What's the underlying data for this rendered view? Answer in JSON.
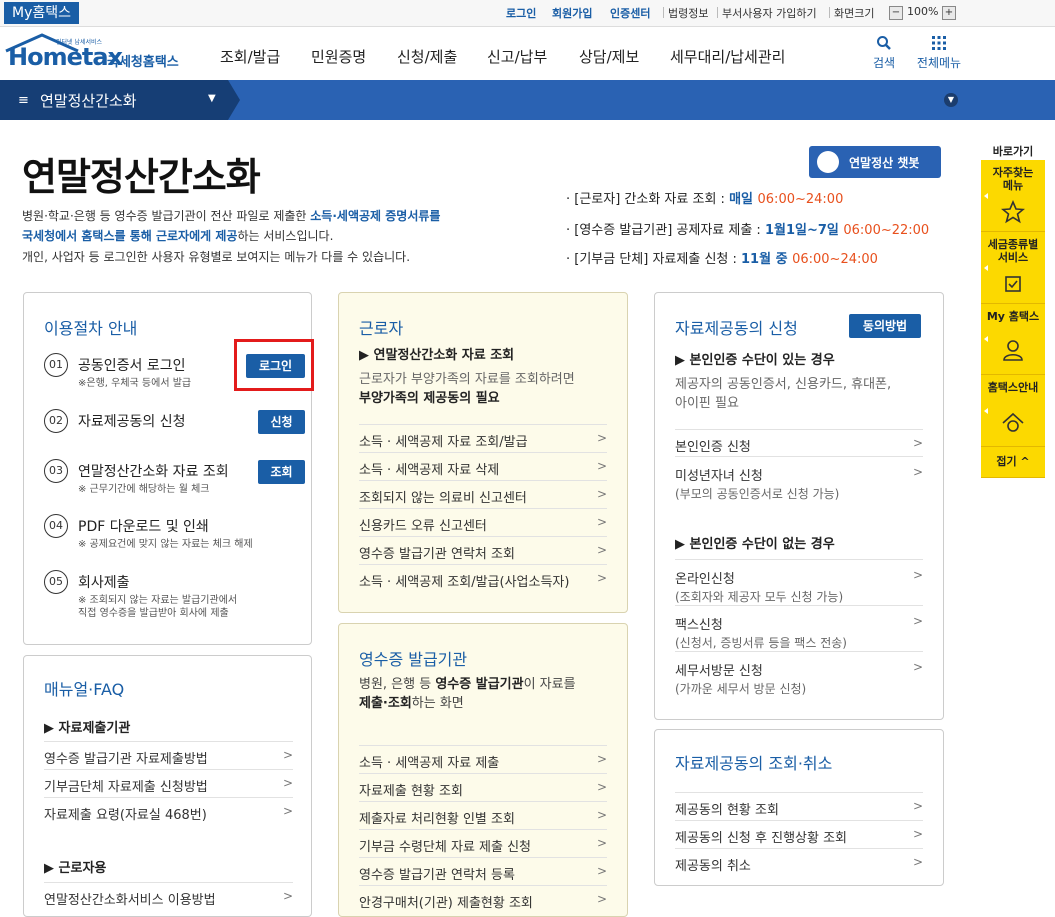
{
  "topbar": {
    "my_hometax": "My홈택스",
    "login": "로그인",
    "join": "회원가입",
    "cert_center": "인증센터",
    "law_info": "법령정보",
    "dept_user_join": "부서사용자 가입하기",
    "screen_size": "화면크기",
    "zoom_minus": "−",
    "zoom_level": "100%",
    "zoom_plus": "+"
  },
  "header": {
    "logo_small": "인터넷 납세서비스",
    "logo_main": "Hometax",
    "logo_sub": "국세청홈택스",
    "menus": [
      "조회/발급",
      "민원증명",
      "신청/제출",
      "신고/납부",
      "상담/제보",
      "세무대리/납세관리"
    ],
    "search_label": "검색",
    "all_menu_label": "전체메뉴"
  },
  "navbar": {
    "title": "연말정산간소화"
  },
  "page": {
    "title": "연말정산간소화",
    "desc1_pre": "병원·학교·은행 등 영수증 발급기관이 전산 파일로 제출한 ",
    "desc1_hl": "소득·세액공제 증명서류를",
    "desc2_hl": "국세청에서 홈택스를 통해 근로자에게 제공",
    "desc2_post": "하는 서비스입니다.",
    "desc3": "개인, 사업자 등 로그인한 사용자 유형별로 보여지는 메뉴가 다를 수 있습니다.",
    "chatbot": "연말정산 챗봇"
  },
  "schedule": [
    {
      "prefix": "· [근로자] 간소화 자료 조회 : ",
      "when": "매일 ",
      "time": "06:00~24:00"
    },
    {
      "prefix": "· [영수증 발급기관] 공제자료 제출 : ",
      "when": "1월1일~7일 ",
      "time": "06:00~22:00"
    },
    {
      "prefix": "· [기부금 단체] 자료제출 신청 : ",
      "when": "11월 중 ",
      "time": "06:00~24:00"
    }
  ],
  "procedure": {
    "title": "이용절차 안내",
    "steps": [
      {
        "num": "01",
        "label": "공동인증서 로그인",
        "note1": "※은행, 우체국 등에서 발급",
        "note2": "",
        "button": "로그인"
      },
      {
        "num": "02",
        "label": "자료제공동의 신청",
        "note1": "",
        "note2": "",
        "button": "신청"
      },
      {
        "num": "03",
        "label": "연말정산간소화 자료 조회",
        "note1": "※ 근무기간에 해당하는 월 체크",
        "note2": "",
        "button": "조회"
      },
      {
        "num": "04",
        "label": "PDF 다운로드 및 인쇄",
        "note1": "※ 공제요건에 맞지 않는 자료는 체크 해제",
        "note2": "",
        "button": ""
      },
      {
        "num": "05",
        "label": "회사제출",
        "note1": "※ 조회되지 않는 자료는 발급기관에서",
        "note2": "직접 영수증을 발급받아 회사에 제출",
        "button": ""
      }
    ]
  },
  "manual": {
    "title": "매뉴얼·FAQ",
    "sub1": "▶ 자료제출기관",
    "items1": [
      "영수증 발급기관 자료제출방법",
      "기부금단체 자료제출 신청방법",
      "자료제출 요령(자료실 468번)"
    ],
    "sub2": "▶ 근로자용",
    "items2": [
      "연말정산간소화서비스 이용방법"
    ]
  },
  "worker": {
    "title": "근로자",
    "sub": "▶ 연말정산간소화 자료 조회",
    "note1": "근로자가 부양가족의 자료를 조회하려면",
    "note2": "부양가족의 제공동의 필요",
    "items": [
      "소득 · 세액공제 자료 조회/발급",
      "소득 · 세액공제 자료 삭제",
      "조회되지 않는 의료비 신고센터",
      "신용카드 오류 신고센터",
      "영수증 발급기관 연락처 조회",
      "소득 · 세액공제 조회/발급(사업소득자)"
    ]
  },
  "issuer": {
    "title": "영수증 발급기관",
    "note1_pre": "병원, 은행 등 ",
    "note1_b": "영수증 발급기관",
    "note1_post": "이 자료를",
    "note2_b": "제출·조회",
    "note2_post": "하는 화면",
    "items": [
      "소득 · 세액공제 자료 제출",
      "자료제출 현황 조회",
      "제출자료 처리현황 인별 조회",
      "기부금 수령단체 자료 제출 신청",
      "영수증 발급기관 연락처 등록",
      "안경구매처(기관) 제출현황 조회"
    ]
  },
  "consent": {
    "title": "자료제공동의 신청",
    "button": "동의방법",
    "sub1": "▶ 본인인증 수단이 있는 경우",
    "note1": "제공자의 공동인증서, 신용카드, 휴대폰,",
    "note2": "아이핀 필요",
    "items1": [
      {
        "label": "본인인증 신청",
        "sub": ""
      },
      {
        "label": "미성년자녀 신청",
        "sub": "(부모의 공동인증서로 신청 가능)"
      }
    ],
    "sub2": "▶ 본인인증 수단이 없는 경우",
    "items2": [
      {
        "label": "온라인신청",
        "sub": "(조회자와 제공자 모두 신청 가능)"
      },
      {
        "label": "팩스신청",
        "sub": "(신청서, 증빙서류 등을 팩스 전송)"
      },
      {
        "label": "세무서방문 신청",
        "sub": "(가까운 세무서 방문 신청)"
      }
    ]
  },
  "consent_query": {
    "title": "자료제공동의 조회·취소",
    "items": [
      "제공동의 현황 조회",
      "제공동의 신청 후 진행상황 조회",
      "제공동의 취소"
    ]
  },
  "quickmenu": {
    "title": "바로가기",
    "items": [
      {
        "l1": "자주찾는",
        "l2": "메뉴"
      },
      {
        "l1": "세금종류별",
        "l2": "서비스"
      },
      {
        "l1": "My 홈택스",
        "l2": ""
      },
      {
        "l1": "홈택스안내",
        "l2": ""
      }
    ],
    "close": "접기 ^"
  }
}
